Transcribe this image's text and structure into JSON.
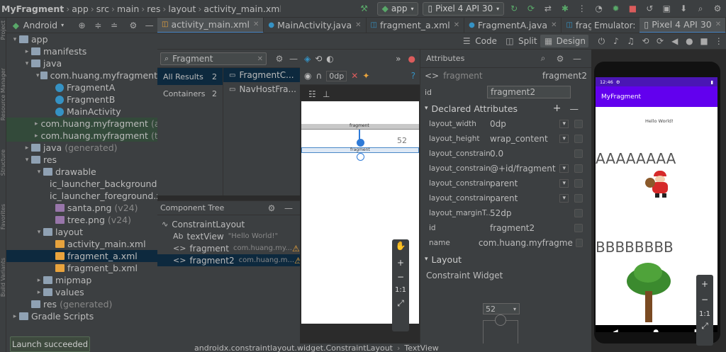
{
  "titlebar": {
    "breadcrumbs": [
      "MyFragment",
      "app",
      "src",
      "main",
      "res",
      "layout",
      "activity_main.xml"
    ],
    "run_config": "app",
    "device": "Pixel 4 API 30"
  },
  "project": {
    "view_label": "Android",
    "items": [
      {
        "label": "app",
        "depth": 0,
        "arrow": "▾",
        "icon": "folder"
      },
      {
        "label": "manifests",
        "depth": 1,
        "arrow": "▸",
        "icon": "folder"
      },
      {
        "label": "java",
        "depth": 1,
        "arrow": "▾",
        "icon": "folder"
      },
      {
        "label": "com.huang.myfragment",
        "depth": 2,
        "arrow": "▾",
        "icon": "pkg"
      },
      {
        "label": "FragmentA",
        "depth": 3,
        "arrow": "",
        "icon": "cls"
      },
      {
        "label": "FragmentB",
        "depth": 3,
        "arrow": "",
        "icon": "cls"
      },
      {
        "label": "MainActivity",
        "depth": 3,
        "arrow": "",
        "icon": "cls"
      },
      {
        "label": "com.huang.myfragment",
        "suffix": "(an",
        "depth": 2,
        "arrow": "▸",
        "icon": "pkg",
        "hl": true
      },
      {
        "label": "com.huang.myfragment",
        "suffix": "(te",
        "depth": 2,
        "arrow": "▸",
        "icon": "pkg",
        "hl": true
      },
      {
        "label": "java",
        "suffix": "(generated)",
        "depth": 1,
        "arrow": "▸",
        "icon": "folder"
      },
      {
        "label": "res",
        "depth": 1,
        "arrow": "▾",
        "icon": "folder"
      },
      {
        "label": "drawable",
        "depth": 2,
        "arrow": "▾",
        "icon": "folder"
      },
      {
        "label": "ic_launcher_background.",
        "depth": 3,
        "arrow": "",
        "icon": "xml"
      },
      {
        "label": "ic_launcher_foreground.x",
        "depth": 3,
        "arrow": "",
        "icon": "xml"
      },
      {
        "label": "santa.png",
        "suffix": "(v24)",
        "depth": 3,
        "arrow": "",
        "icon": "img"
      },
      {
        "label": "tree.png",
        "suffix": "(v24)",
        "depth": 3,
        "arrow": "",
        "icon": "img"
      },
      {
        "label": "layout",
        "depth": 2,
        "arrow": "▾",
        "icon": "folder"
      },
      {
        "label": "activity_main.xml",
        "depth": 3,
        "arrow": "",
        "icon": "xml"
      },
      {
        "label": "fragment_a.xml",
        "depth": 3,
        "arrow": "",
        "icon": "xml",
        "sel": true
      },
      {
        "label": "fragment_b.xml",
        "depth": 3,
        "arrow": "",
        "icon": "xml"
      },
      {
        "label": "mipmap",
        "depth": 2,
        "arrow": "▸",
        "icon": "folder"
      },
      {
        "label": "values",
        "depth": 2,
        "arrow": "▸",
        "icon": "folder"
      },
      {
        "label": "res",
        "suffix": "(generated)",
        "depth": 1,
        "arrow": "",
        "icon": "folder"
      },
      {
        "label": "Gradle Scripts",
        "depth": 0,
        "arrow": "▸",
        "icon": "folder"
      }
    ]
  },
  "side_labels": [
    "Project",
    "Resource Manager",
    "Structure",
    "Favorites",
    "Build Variants"
  ],
  "tabs": [
    {
      "label": "activity_main.xml",
      "active": true
    },
    {
      "label": "MainActivity.java"
    },
    {
      "label": "fragment_a.xml"
    },
    {
      "label": "FragmentA.java"
    },
    {
      "label": "fragment_b.xn"
    }
  ],
  "emulator": {
    "label": "Emulator:",
    "device": "Pixel 4 API 30"
  },
  "modes": {
    "code": "Code",
    "split": "Split",
    "design": "Design"
  },
  "palette": {
    "search_value": "Fragment",
    "categories": [
      {
        "label": "All Results",
        "count": "2"
      },
      {
        "label": "Containers",
        "count": "2"
      }
    ],
    "results": [
      "FragmentC...",
      "NavHostFra..."
    ]
  },
  "canvas": {
    "dp": "0dp",
    "margin_badge": "52",
    "frag_label": "fragment",
    "frag_label2": "fragment"
  },
  "component_tree": {
    "title": "Component Tree",
    "items": [
      {
        "label": "ConstraintLayout",
        "sub": "",
        "depth": 0
      },
      {
        "label": "textView",
        "sub": "\"Hello World!\"",
        "depth": 1,
        "prefix": "Ab"
      },
      {
        "label": "fragment",
        "sub": "com.huang.my...",
        "depth": 1,
        "prefix": "<>",
        "warn": true
      },
      {
        "label": "fragment2",
        "sub": "com.huang.m...",
        "depth": 1,
        "prefix": "<>",
        "warn": true,
        "sel": true
      }
    ]
  },
  "attributes": {
    "title": "Attributes",
    "tag": "fragment",
    "tag_id": "fragment2",
    "id_label": "id",
    "id_value": "fragment2",
    "declared_title": "Declared Attributes",
    "declared": [
      {
        "k": "layout_width",
        "v": "0dp",
        "dd": true
      },
      {
        "k": "layout_height",
        "v": "wrap_content",
        "dd": true
      },
      {
        "k": "layout_constrain...",
        "v": "0.0"
      },
      {
        "k": "layout_constrain...",
        "v": "@+id/fragment",
        "dd": true
      },
      {
        "k": "layout_constrain...",
        "v": "parent",
        "dd": true
      },
      {
        "k": "layout_constrain...",
        "v": "parent",
        "dd": true
      },
      {
        "k": "layout_marginT...",
        "v": "52dp"
      },
      {
        "k": "id",
        "v": "fragment2"
      },
      {
        "k": "name",
        "v": "com.huang.myfragme"
      }
    ],
    "layout_title": "Layout",
    "constraint_label": "Constraint Widget",
    "constraint_value": "52"
  },
  "phone": {
    "time": "12:46",
    "app_title": "MyFragment",
    "hello": "Hello World!",
    "text_a": "AAAAAAAA",
    "text_b": "BBBBBBBB"
  },
  "bottom": {
    "path": "androidx.constraintlayout.widget.ConstraintLayout",
    "sep": "›",
    "leaf": "TextView"
  },
  "toast": "Launch succeeded",
  "colors": {
    "accent": "#6200ee",
    "status": "#4a16b4",
    "selection": "#0d293e"
  }
}
